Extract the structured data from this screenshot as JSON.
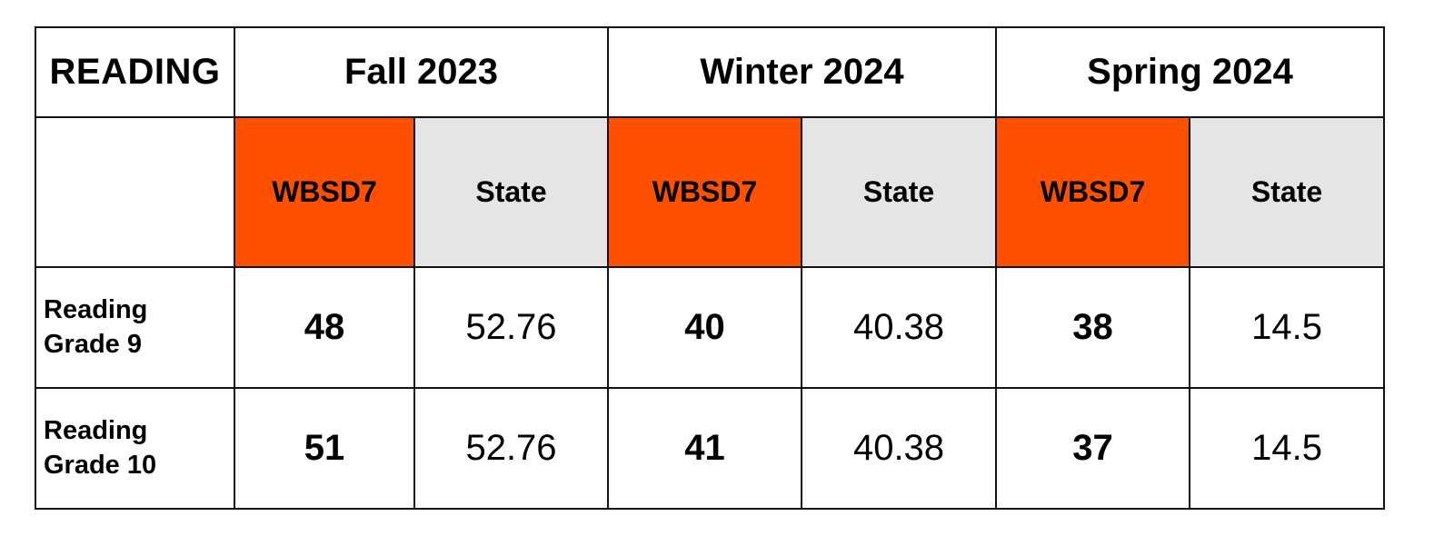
{
  "table": {
    "title": "READING",
    "terms": [
      "Fall 2023",
      "Winter 2024",
      "Spring 2024"
    ],
    "subheaders": [
      "WBSD7",
      "State",
      "WBSD7",
      "State",
      "WBSD7",
      "State"
    ],
    "rows": [
      {
        "label_line1": "Reading",
        "label_line2": "Grade 9",
        "values": [
          "48",
          "52.76",
          "40",
          "40.38",
          "38",
          "14.5"
        ]
      },
      {
        "label_line1": "Reading",
        "label_line2": "Grade 10",
        "values": [
          "51",
          "52.76",
          "41",
          "40.38",
          "37",
          "14.5"
        ]
      }
    ]
  },
  "colors": {
    "accent": "#ff5000",
    "state_header_bg": "#e5e5e5"
  }
}
